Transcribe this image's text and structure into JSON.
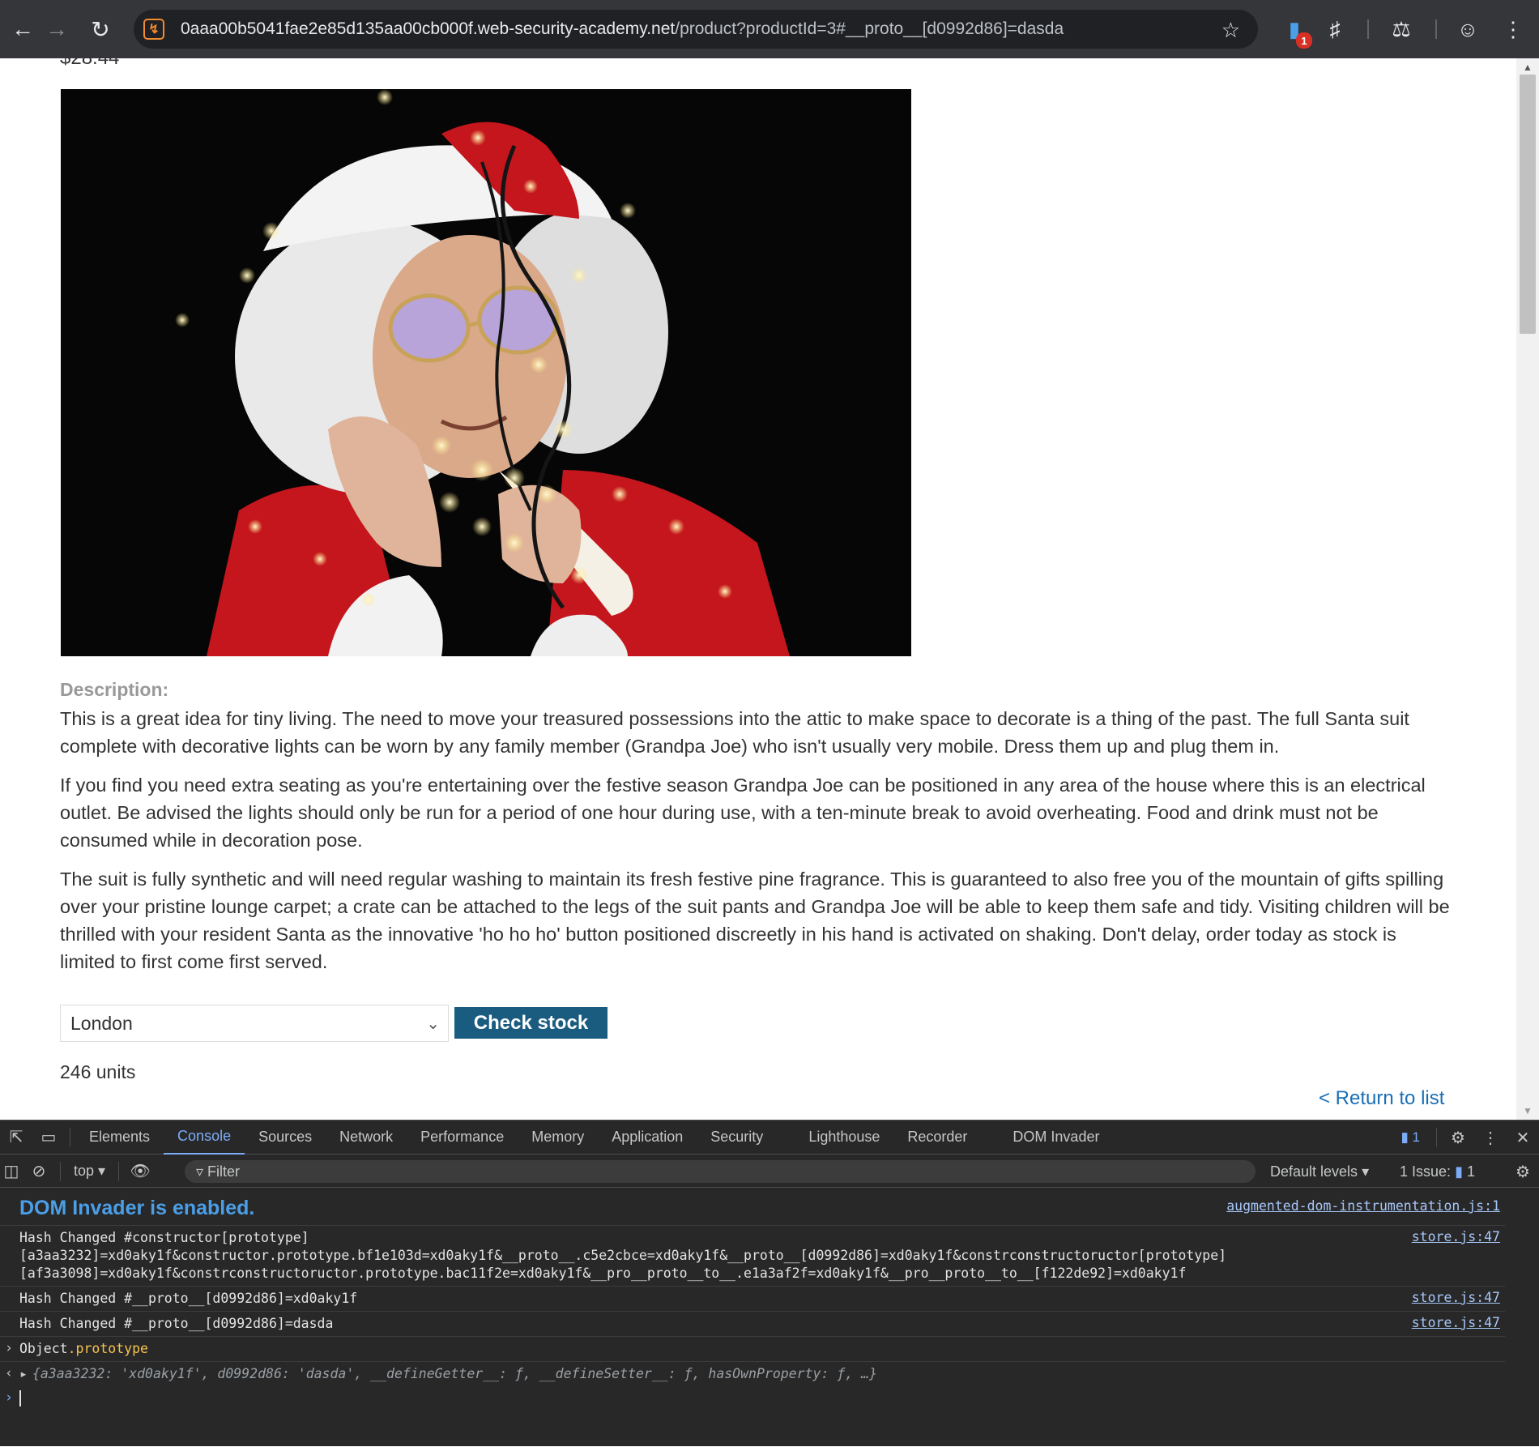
{
  "browser": {
    "url_host": "0aaa00b5041fae2e85d135aa00cb000f.web-security-academy.net",
    "url_path": "/product?productId=3#__proto__[d0992d86]=dasda",
    "extension_badge": "1"
  },
  "page": {
    "price_partial": "$28.44",
    "description_label": "Description:",
    "description_paragraphs": [
      "This is a great idea for tiny living. The need to move your treasured possessions into the attic to make space to decorate is a thing of the past. The full Santa suit complete with decorative lights can be worn by any family member (Grandpa Joe) who isn't usually very mobile. Dress them up and plug them in.",
      "If you find you need extra seating as you're entertaining over the festive season Grandpa Joe can be positioned in any area of the house where this is an electrical outlet. Be advised the lights should only be run for a period of one hour during use, with a ten-minute break to avoid overheating. Food and drink must not be consumed while in decoration pose.",
      "The suit is fully synthetic and will need regular washing to maintain its fresh festive pine fragrance. This is guaranteed to also free you of the mountain of gifts spilling over your pristine lounge carpet; a crate can be attached to the legs of the suit pants and Grandpa Joe will be able to keep them safe and tidy. Visiting children will be thrilled with your resident Santa as the innovative 'ho ho ho' button positioned discreetly in his hand is activated on shaking. Don't delay, order today as stock is limited to first come first served."
    ],
    "store_select_value": "London",
    "check_stock_label": "Check stock",
    "stock_result": "246 units",
    "return_link": "< Return to list"
  },
  "devtools": {
    "tabs": [
      "Elements",
      "Console",
      "Sources",
      "Network",
      "Performance",
      "Memory",
      "Application",
      "Security",
      "Lighthouse",
      "Recorder",
      "DOM Invader"
    ],
    "active_tab": "Console",
    "message_count": "1",
    "context": "top",
    "filter_placeholder": "Filter",
    "levels": "Default levels",
    "issues_label": "1 Issue:",
    "issues_count": "1",
    "console": {
      "invader_banner": "DOM Invader is enabled.",
      "invader_source": "augmented-dom-instrumentation.js:1",
      "entries": [
        {
          "lines": [
            "Hash Changed #constructor[prototype]",
            "[a3aa3232]=xd0aky1f&constructor.prototype.bf1e103d=xd0aky1f&__proto__.c5e2cbce=xd0aky1f&__proto__[d0992d86]=xd0aky1f&constrconstructoructor[prototype]",
            "[af3a3098]=xd0aky1f&constrconstructoructor.prototype.bac11f2e=xd0aky1f&__pro__proto__to__.e1a3af2f=xd0aky1f&__pro__proto__to__[f122de92]=xd0aky1f"
          ],
          "source": "store.js:47"
        },
        {
          "lines": [
            "Hash Changed #__proto__[d0992d86]=xd0aky1f"
          ],
          "source": "store.js:47"
        },
        {
          "lines": [
            "Hash Changed #__proto__[d0992d86]=dasda"
          ],
          "source": "store.js:47"
        }
      ],
      "input_object": "Object",
      "input_property": ".prototype",
      "result_text": "{a3aa3232: 'xd0aky1f', d0992d86: 'dasda', __defineGetter__: ƒ, __defineSetter__: ƒ, hasOwnProperty: ƒ, …}"
    }
  }
}
